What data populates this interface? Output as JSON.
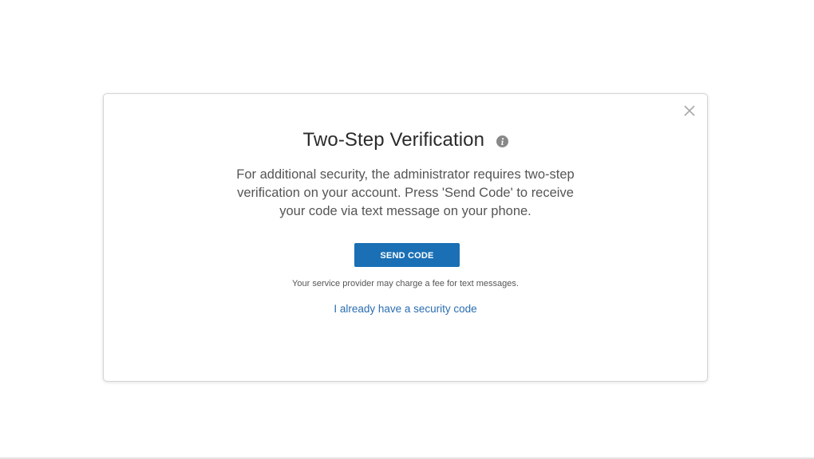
{
  "modal": {
    "title": "Two-Step Verification",
    "description_lines": [
      "For additional security, the administrator requires two-step",
      "verification on your account. Press 'Send Code' to receive",
      "your code via text message on your phone."
    ],
    "send_button_label": "SEND CODE",
    "fee_note": "Your service provider may charge a fee for text messages.",
    "security_code_link": "I already have a security code"
  },
  "icons": {
    "close": "close-icon",
    "info": "info-icon"
  },
  "colors": {
    "primary_button": "#1a6fb5",
    "link": "#2a6db0",
    "title_text": "#2b2b2b",
    "body_text": "#555555",
    "info_icon": "#888888"
  }
}
